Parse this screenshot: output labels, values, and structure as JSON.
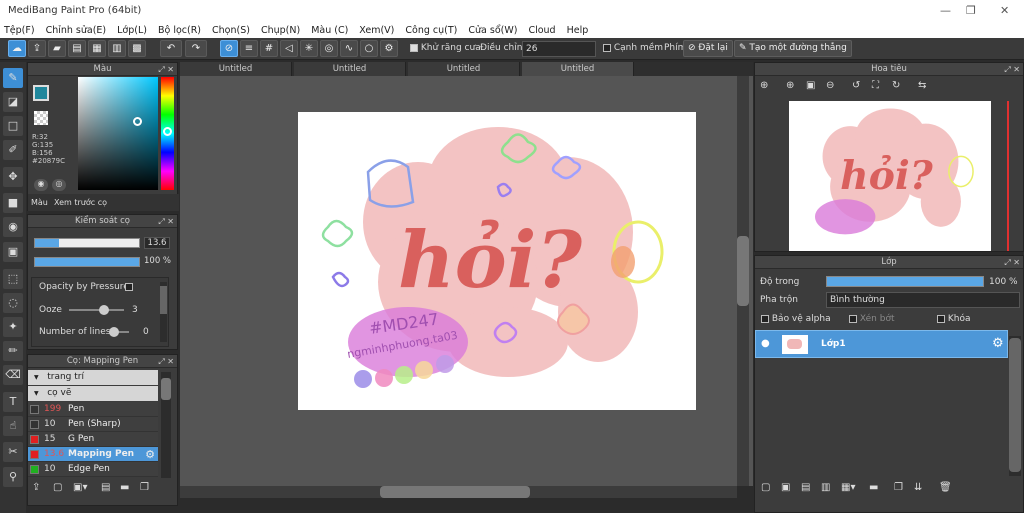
{
  "window": {
    "title": "MediBang Paint Pro (64bit)",
    "min": "—",
    "restore": "❐",
    "close": "✕"
  },
  "menu": [
    "Tệp(F)",
    "Chỉnh sửa(E)",
    "Lớp(L)",
    "Bộ lọc(R)",
    "Chọn(S)",
    "Chụp(N)",
    "Màu (C)",
    "Xem(V)",
    "Công cụ(T)",
    "Cửa sổ(W)",
    "Cloud",
    "Help"
  ],
  "toolbar": {
    "antialias": "Khử răng cưa",
    "correction_label": "Điều chỉnh",
    "correction_value": "26",
    "snap": "Cạnh mềm",
    "key_label": "Phím",
    "reset": "Đặt lại",
    "straight": "Tạo một đường thẳng"
  },
  "tabs": [
    "Untitled",
    "Untitled",
    "Untitled",
    "Untitled"
  ],
  "color": {
    "title": "Màu",
    "r": "R:32",
    "g": "G:135",
    "b": "B:156",
    "hex": "#20879C",
    "tab1": "Màu",
    "tab2": "Xem trước cọ",
    "current": "#20879C"
  },
  "brush_control": {
    "title": "Kiểm soát cọ",
    "size": "13.6",
    "opacity": "100 %",
    "pressure": "Opacity by Pressure",
    "ooze_label": "Ooze",
    "ooze": "3",
    "lines_label": "Number of lines",
    "lines": "0",
    "size_fraction": 0.23,
    "opacity_fraction": 1.0
  },
  "brush_list": {
    "title": "Cọ: Mapping Pen",
    "groups": [
      "trang trí",
      "cọ vẽ"
    ],
    "items": [
      {
        "size": "199",
        "name": "Pen",
        "color": "#333333",
        "sizecolor": "#e05555"
      },
      {
        "size": "10",
        "name": "Pen (Sharp)",
        "color": "#333333",
        "sizecolor": "#dddddd"
      },
      {
        "size": "15",
        "name": "G Pen",
        "color": "#e02020",
        "sizecolor": "#dddddd"
      },
      {
        "size": "13.6",
        "name": "Mapping Pen",
        "color": "#e02020",
        "sizecolor": "#e05555"
      },
      {
        "size": "10",
        "name": "Edge Pen",
        "color": "#20b020",
        "sizecolor": "#dddddd"
      }
    ]
  },
  "navigator": {
    "title": "Hoa tiêu"
  },
  "layers": {
    "title": "Lớp",
    "opacity_label": "Độ trong",
    "opacity": "100 %",
    "blend_label": "Pha trộn",
    "blend": "Bình thường",
    "protect": "Bảo vệ alpha",
    "clip": "Xén bớt",
    "lock": "Khóa",
    "layer_name": "Lớp1",
    "opacity_fraction": 1.0
  },
  "artwork": {
    "word": "hỏi?",
    "tag": "#MD247",
    "credit": "ngminhphuong.ta03"
  }
}
